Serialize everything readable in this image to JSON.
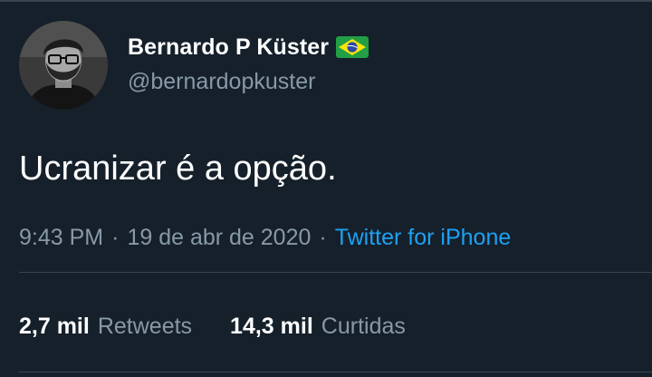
{
  "tweet": {
    "author": {
      "display_name": "Bernardo P Küster",
      "handle": "@bernardopkuster",
      "flag_icon": "brazil-flag-icon"
    },
    "text": "Ucranizar é a opção.",
    "meta": {
      "time": "9:43 PM",
      "separator": "·",
      "date": "19 de abr de 2020",
      "source": "Twitter for iPhone"
    },
    "stats": {
      "retweets_count": "2,7 mil",
      "retweets_label": "Retweets",
      "likes_count": "14,3 mil",
      "likes_label": "Curtidas"
    }
  },
  "colors": {
    "background": "#15202b",
    "divider": "#38444d",
    "secondary_text": "#8899a6",
    "link": "#1da1f2",
    "primary_text": "#ffffff"
  }
}
